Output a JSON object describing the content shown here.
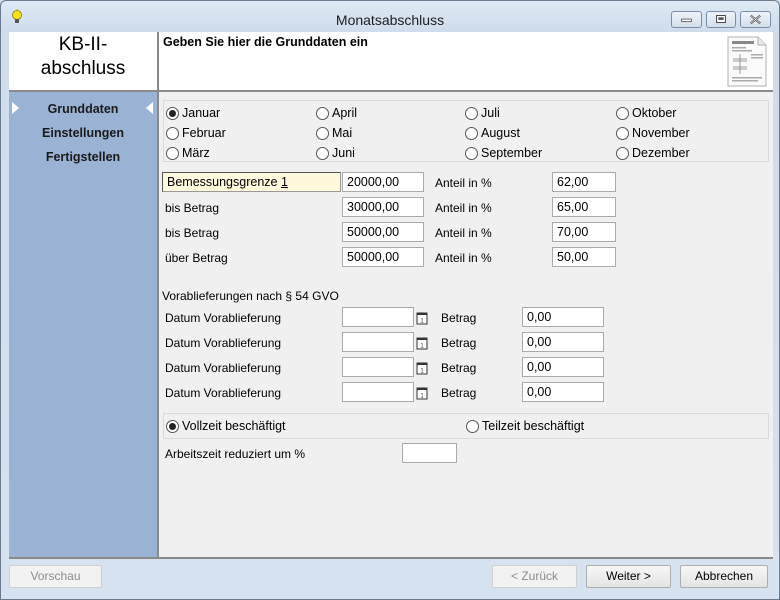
{
  "window": {
    "title": "Monatsabschluss",
    "icons": {
      "app": "lightbulb-icon",
      "minimize": "minimize-icon",
      "maximize": "maximize-icon",
      "close": "close-icon"
    }
  },
  "header": {
    "wizard_title_line1": "KB-II-",
    "wizard_title_line2": "abschluss",
    "instruction": "Geben Sie hier die Grunddaten ein",
    "icon": "document-icon"
  },
  "sidebar": {
    "items": [
      {
        "label": "Grunddaten",
        "active": true
      },
      {
        "label": "Einstellungen",
        "active": false
      },
      {
        "label": "Fertigstellen",
        "active": false
      }
    ]
  },
  "months": {
    "selected": "Januar",
    "options": [
      "Januar",
      "Februar",
      "März",
      "April",
      "Mai",
      "Juni",
      "Juli",
      "August",
      "September",
      "Oktober",
      "November",
      "Dezember"
    ]
  },
  "thresholds": {
    "rows": [
      {
        "label": "Bemessungsgrenze 1",
        "label_prefix": "Bemessungsgrenze ",
        "label_accel": "1",
        "amount": "20000,00",
        "share_label": "Anteil in %",
        "share": "62,00"
      },
      {
        "label": "bis Betrag",
        "amount": "30000,00",
        "share_label": "Anteil in %",
        "share": "65,00"
      },
      {
        "label": "bis Betrag",
        "amount": "50000,00",
        "share_label": "Anteil in %",
        "share": "70,00"
      },
      {
        "label": "über Betrag",
        "amount": "50000,00",
        "share_label": "Anteil in %",
        "share": "50,00"
      }
    ]
  },
  "advance_deliveries": {
    "heading": "Vorablieferungen nach § 54 GVO",
    "rows": [
      {
        "date_label": "Datum Vorablieferung",
        "date": "",
        "amount_label": "Betrag",
        "amount": "0,00"
      },
      {
        "date_label": "Datum Vorablieferung",
        "date": "",
        "amount_label": "Betrag",
        "amount": "0,00"
      },
      {
        "date_label": "Datum Vorablieferung",
        "date": "",
        "amount_label": "Betrag",
        "amount": "0,00"
      },
      {
        "date_label": "Datum Vorablieferung",
        "date": "",
        "amount_label": "Betrag",
        "amount": "0,00"
      }
    ],
    "calendar_icon": "calendar-icon"
  },
  "employment": {
    "fulltime_label": "Vollzeit beschäftigt",
    "parttime_label": "Teilzeit beschäftigt",
    "selected": "fulltime",
    "reduction_label": "Arbeitszeit reduziert um %",
    "reduction_value": ""
  },
  "footer": {
    "preview": "Vorschau",
    "back": "< Zurück",
    "next": "Weiter >",
    "cancel": "Abbrechen"
  }
}
